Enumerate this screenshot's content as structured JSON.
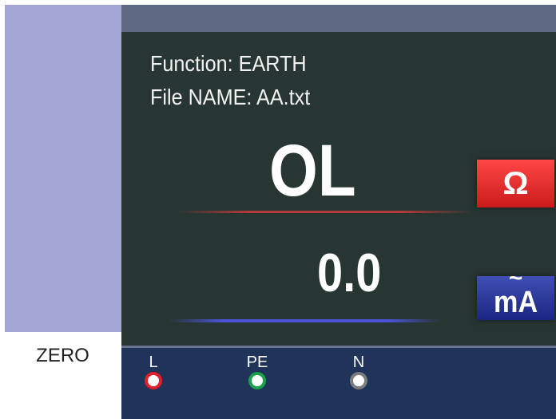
{
  "display": {
    "function_line": "Function: EARTH",
    "file_line": "File NAME: AA.txt",
    "main_reading": "OL",
    "secondary_reading": "0.0"
  },
  "units": {
    "primary": "Ω",
    "primary_color": "#e52a2a",
    "secondary": "mA",
    "secondary_ac_symbol": "~",
    "secondary_color": "#2a36a0"
  },
  "zero_button": {
    "label": "ZERO"
  },
  "terminals": [
    {
      "label": "L",
      "color": "#e0202a"
    },
    {
      "label": "PE",
      "color": "#1aa24a"
    },
    {
      "label": "N",
      "color": "#7d7d7d"
    }
  ],
  "colors": {
    "sidebar": "#a3a6d4",
    "topbar": "#5d6883",
    "screen_background": "#283633",
    "terminal_strip": "#203459"
  }
}
